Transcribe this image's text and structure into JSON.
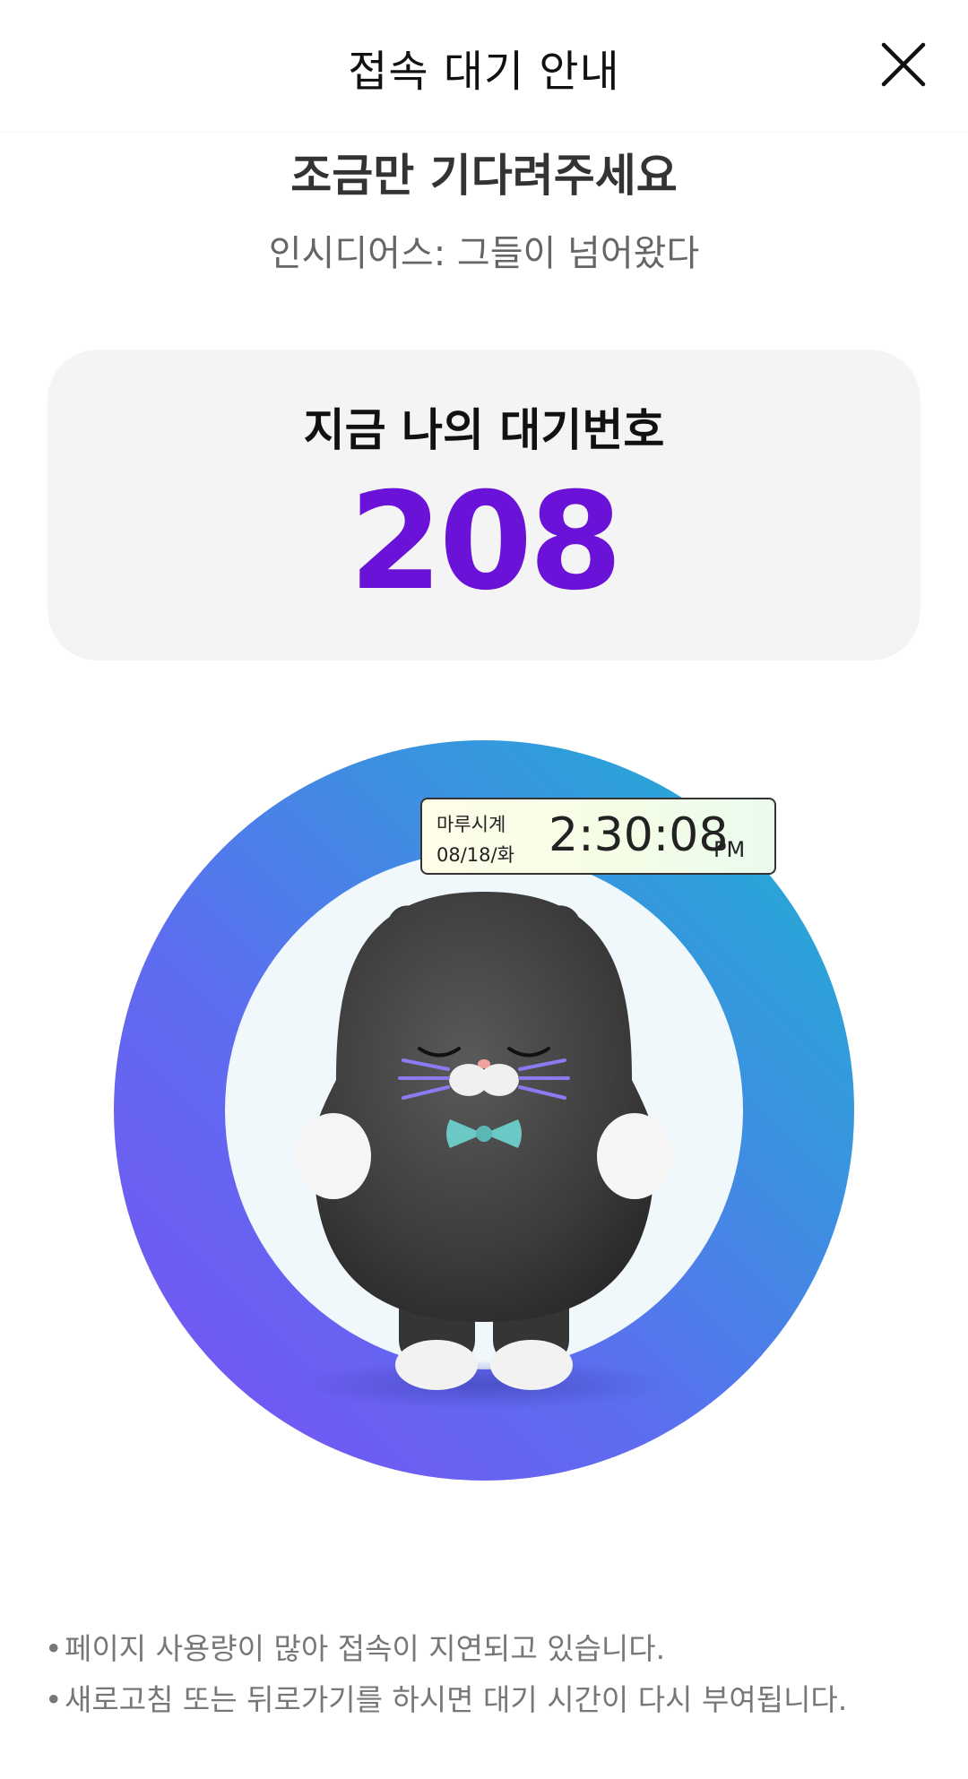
{
  "header": {
    "title": "접속 대기 안내",
    "close_icon": "close-icon"
  },
  "main": {
    "heading": "조금만 기다려주세요",
    "subheading": "인시디어스: 그들이 넘어왔다"
  },
  "queue": {
    "label": "지금 나의 대기번호",
    "number": "208",
    "number_color": "#6a12d8"
  },
  "clock": {
    "name": "마루시계",
    "date": "08/18/화",
    "time": "2:30:08",
    "ampm": "PM"
  },
  "illustration": {
    "ring_colors": [
      "#1cb3d1",
      "#3e8ee2",
      "#5e6cf0",
      "#7a4ff5"
    ],
    "character": "black-cat-mascot-icon"
  },
  "notices": {
    "bullet": "•",
    "items": [
      "페이지 사용량이 많아 접속이 지연되고 있습니다.",
      "새로고침 또는 뒤로가기를 하시면 대기 시간이 다시 부여됩니다."
    ]
  }
}
